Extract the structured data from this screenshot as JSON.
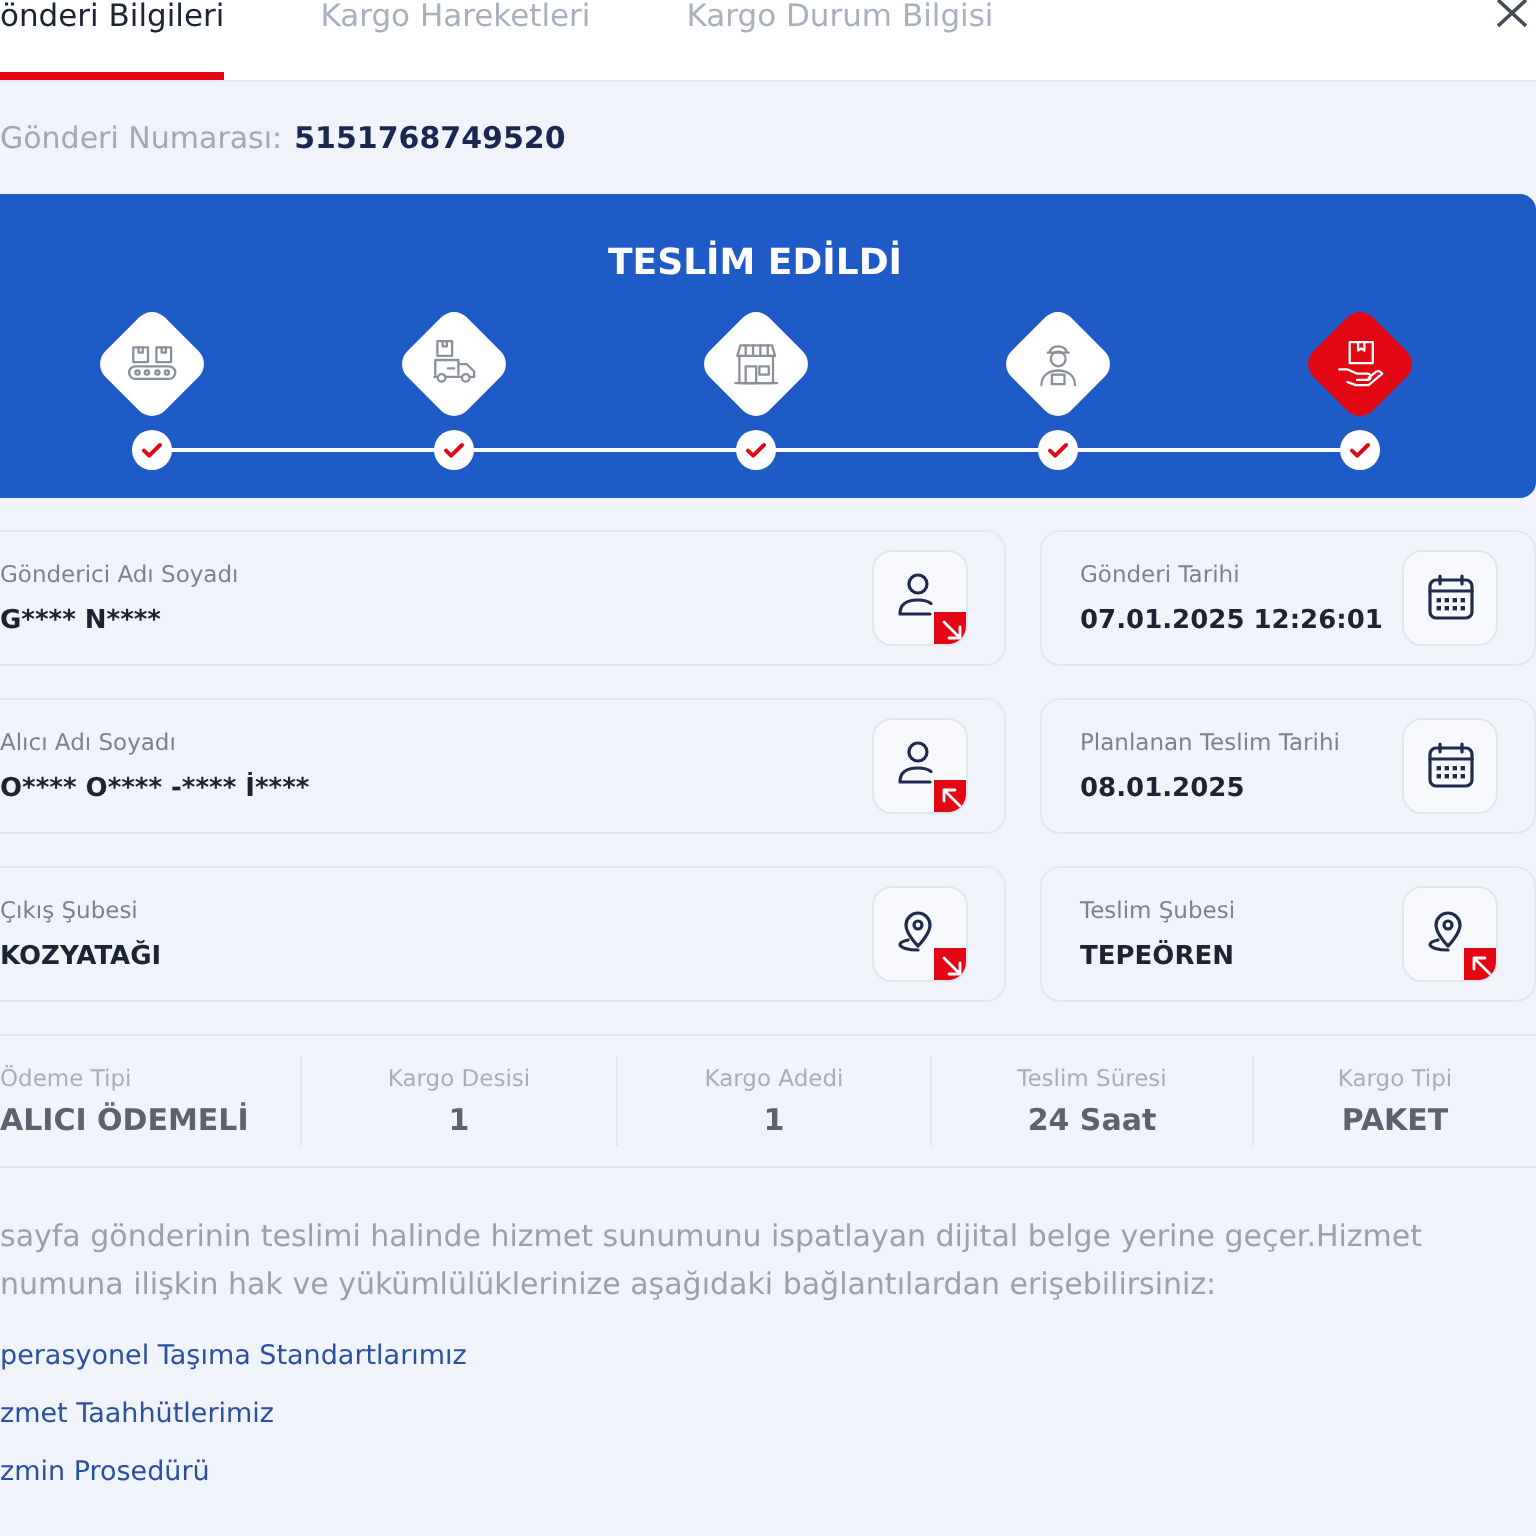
{
  "tabs": [
    {
      "label": "önderi Bilgileri",
      "selected": true
    },
    {
      "label": "Kargo Hareketleri",
      "selected": false
    },
    {
      "label": "Kargo Durum Bilgisi",
      "selected": false
    }
  ],
  "shipment": {
    "label": "Gönderi Numarası:",
    "number": "5151768749520"
  },
  "status": {
    "title": "TESLİM EDİLDİ",
    "steps": [
      {
        "kind": "sorting",
        "done": true,
        "selected": false
      },
      {
        "kind": "transfer",
        "done": true,
        "selected": false
      },
      {
        "kind": "branch",
        "done": true,
        "selected": false
      },
      {
        "kind": "courier",
        "done": true,
        "selected": false
      },
      {
        "kind": "delivered",
        "done": true,
        "selected": true
      }
    ]
  },
  "details": [
    {
      "kind": "sender",
      "label": "Gönderici Adı Soyadı",
      "value": "G**** N****"
    },
    {
      "kind": "date",
      "label": "Gönderi Tarihi",
      "value": "07.01.2025 12:26:01"
    },
    {
      "kind": "receiver",
      "label": "Alıcı Adı Soyadı",
      "value": "O**** O**** -**** İ****"
    },
    {
      "kind": "date",
      "label": "Planlanan Teslim Tarihi",
      "value": "08.01.2025"
    },
    {
      "kind": "origin",
      "label": "Çıkış Şubesi",
      "value": "KOZYATAĞI"
    },
    {
      "kind": "destination",
      "label": "Teslim Şubesi",
      "value": "TEPEÖREN"
    }
  ],
  "summary": [
    {
      "label": "Ödeme Tipi",
      "value": "ALICI ÖDEMELİ"
    },
    {
      "label": "Kargo Desisi",
      "value": "1"
    },
    {
      "label": "Kargo Adedi",
      "value": "1"
    },
    {
      "label": "Teslim Süresi",
      "value": "24 Saat"
    },
    {
      "label": "Kargo Tipi",
      "value": "PAKET"
    }
  ],
  "notice": {
    "lines": [
      "sayfa gönderinin teslimi halinde hizmet sunumunu ispatlayan dijital belge yerine geçer.Hizmet",
      "numuna ilişkin hak ve yükümlülüklerinize aşağıdaki bağlantılardan erişebilirsiniz:"
    ]
  },
  "links": [
    "perasyonel Taşıma Standartlarımız",
    "zmet Taahhütlerimiz",
    "zmin Prosedürü"
  ]
}
